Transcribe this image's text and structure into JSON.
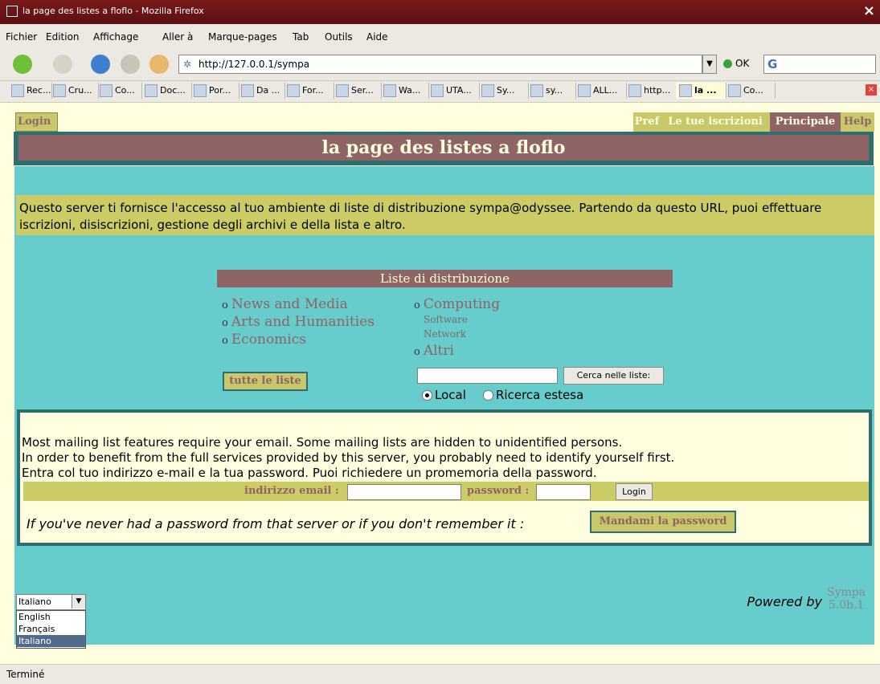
{
  "window": {
    "title": "la page des listes a floflo - Mozilla Firefox"
  },
  "menubar": [
    "Fichier",
    "Edition",
    "Affichage",
    "Aller à",
    "Marque-pages",
    "Tab",
    "Outils",
    "Aide"
  ],
  "navbar": {
    "url": "http://127.0.0.1/sympa",
    "ok_label": "OK",
    "search_logo": "G"
  },
  "bookmarks": [
    "Rec...",
    "Cru...",
    "Co...",
    "Doc...",
    "Por...",
    "Da ...",
    "For...",
    "Ser...",
    "Wa...",
    "UTA...",
    "Sy...",
    "sy...",
    "ALL...",
    "http...",
    "la ...",
    "Co..."
  ],
  "page": {
    "login_link": "Login",
    "top_menu": {
      "pref": "Pref",
      "subscriptions": "Le tue iscrizioni",
      "main": "Principale",
      "help": "Help"
    },
    "title": "la page des listes a floflo",
    "intro": "Questo server ti fornisce l'accesso al tuo ambiente di liste di distribuzione sympa@odyssee. Partendo da questo URL, puoi effettuare iscrizioni, disiscrizioni, gestione degli archivi e della lista e altro.",
    "lists_header": "Liste di distribuzione",
    "categories_left": [
      "News and Media",
      "Arts and Humanities",
      "Economics"
    ],
    "category_computing": "Computing",
    "computing_sub": [
      "Software",
      "Network"
    ],
    "category_other": "Altri",
    "bullet": "o",
    "all_lists_button": "tutte le liste",
    "search": {
      "value": "",
      "button": "Cerca nelle liste:",
      "local": "Local",
      "extended": "Ricerca estesa"
    },
    "login": {
      "line1": "Most mailing list features require your email. Some mailing lists are hidden to unidentified persons.",
      "line2": "In order to benefit from the full services provided by this server, you probably need to identify yourself first.",
      "line3": "Entra col tuo indirizzo e-mail e la tua password. Puoi richiedere un promemoria della password.",
      "email_label": "indirizzo email :",
      "password_label": "password :",
      "button": "Login",
      "no_password": "If you've never had a password from that server or if you don't remember it :",
      "send_password": "Mandami la password"
    },
    "language": {
      "selected": "Italiano",
      "options": [
        "English",
        "Français",
        "Italiano"
      ]
    },
    "powered_by": "Powered by",
    "sympa_name": "Sympa",
    "sympa_version": "5.0b.1"
  },
  "status": "Terminé",
  "colors": {
    "title_bg": "#8e6464",
    "teal": "#66cccc",
    "olive": "#cccc66",
    "cream": "#ffffe0",
    "border": "#2e6e6e"
  }
}
